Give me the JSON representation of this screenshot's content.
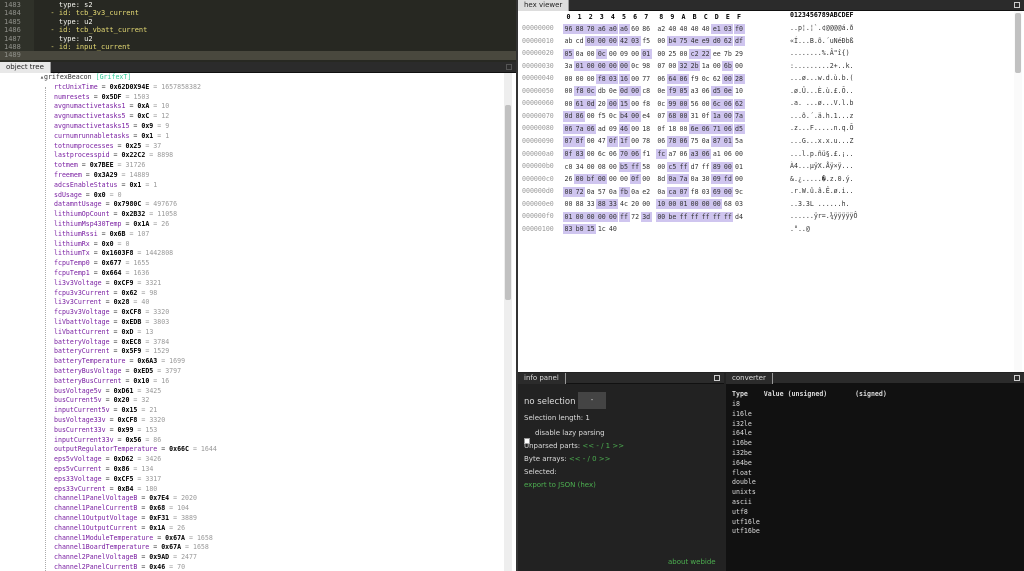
{
  "editor": {
    "lines": [
      {
        "num": "1483",
        "text": "    type: s2",
        "kind": "type"
      },
      {
        "num": "1484",
        "text": "  - id: tcb_3v3_current",
        "kind": "id"
      },
      {
        "num": "1485",
        "text": "    type: u2",
        "kind": "type"
      },
      {
        "num": "1486",
        "text": "  - id: tcb_vbatt_current",
        "kind": "id"
      },
      {
        "num": "1487",
        "text": "    type: u2",
        "kind": "type"
      },
      {
        "num": "1488",
        "text": "  - id: input_current",
        "kind": "id"
      },
      {
        "num": "1489",
        "text": "",
        "kind": "empty"
      }
    ]
  },
  "object_tree": {
    "tab": "object tree",
    "root": "grifexBeacon",
    "root_class": "[GrifexT]",
    "rows": [
      {
        "name": "rtcUnixTime",
        "hex": "0x62D0X94E",
        "dec": "1657858382"
      },
      {
        "name": "numresets",
        "hex": "0x5DF",
        "dec": "1503"
      },
      {
        "name": "avgnumactivetasks1",
        "hex": "0xA",
        "dec": "10"
      },
      {
        "name": "avgnumactivetasks5",
        "hex": "0xC",
        "dec": "12"
      },
      {
        "name": "avgnumactivetasks15",
        "hex": "0x9",
        "dec": "9"
      },
      {
        "name": "curnumrunnabletasks",
        "hex": "0x1",
        "dec": "1"
      },
      {
        "name": "totnumprocesses",
        "hex": "0x25",
        "dec": "37"
      },
      {
        "name": "lastprocesspid",
        "hex": "0x22C2",
        "dec": "8898"
      },
      {
        "name": "totmem",
        "hex": "0x7BEE",
        "dec": "31726"
      },
      {
        "name": "freemem",
        "hex": "0x3A29",
        "dec": "14889"
      },
      {
        "name": "adcsEnableStatus",
        "hex": "0x1",
        "dec": "1"
      },
      {
        "name": "sdUsage",
        "hex": "0x0",
        "dec": "0"
      },
      {
        "name": "datamntUsage",
        "hex": "0x7980C",
        "dec": "497676"
      },
      {
        "name": "lithiumOpCount",
        "hex": "0x2B32",
        "dec": "11058"
      },
      {
        "name": "lithiumMsp430Temp",
        "hex": "0x1A",
        "dec": "26"
      },
      {
        "name": "lithiumRssi",
        "hex": "0x6B",
        "dec": "107"
      },
      {
        "name": "lithiumRx",
        "hex": "0x0",
        "dec": "0"
      },
      {
        "name": "lithiumTx",
        "hex": "0x1603F8",
        "dec": "1442808"
      },
      {
        "name": "fcpuTemp0",
        "hex": "0x677",
        "dec": "1655"
      },
      {
        "name": "fcpuTemp1",
        "hex": "0x664",
        "dec": "1636"
      },
      {
        "name": "li3v3Voltage",
        "hex": "0xCF9",
        "dec": "3321"
      },
      {
        "name": "fcpu3v3Current",
        "hex": "0x62",
        "dec": "98"
      },
      {
        "name": "li3v3Current",
        "hex": "0x28",
        "dec": "40"
      },
      {
        "name": "fcpu3v3Voltage",
        "hex": "0xCF8",
        "dec": "3320"
      },
      {
        "name": "liVbattVoltage",
        "hex": "0xEDB",
        "dec": "3803"
      },
      {
        "name": "liVbattCurrent",
        "hex": "0xD",
        "dec": "13"
      },
      {
        "name": "batteryVoltage",
        "hex": "0xEC8",
        "dec": "3784"
      },
      {
        "name": "batteryCurrent",
        "hex": "0x5F9",
        "dec": "1529"
      },
      {
        "name": "batteryTemperature",
        "hex": "0x6A3",
        "dec": "1699"
      },
      {
        "name": "batteryBusVoltage",
        "hex": "0xED5",
        "dec": "3797"
      },
      {
        "name": "batteryBusCurrent",
        "hex": "0x10",
        "dec": "16"
      },
      {
        "name": "busVoltage5v",
        "hex": "0xD61",
        "dec": "3425"
      },
      {
        "name": "busCurrent5v",
        "hex": "0x20",
        "dec": "32"
      },
      {
        "name": "inputCurrent5v",
        "hex": "0x15",
        "dec": "21"
      },
      {
        "name": "busVoltage33v",
        "hex": "0xCF8",
        "dec": "3320"
      },
      {
        "name": "busCurrent33v",
        "hex": "0x99",
        "dec": "153"
      },
      {
        "name": "inputCurrent33v",
        "hex": "0x56",
        "dec": "86"
      },
      {
        "name": "outputRegulatorTemperature",
        "hex": "0x66C",
        "dec": "1644"
      },
      {
        "name": "eps5vVoltage",
        "hex": "0xD62",
        "dec": "3426"
      },
      {
        "name": "eps5vCurrent",
        "hex": "0x86",
        "dec": "134"
      },
      {
        "name": "eps33Voltage",
        "hex": "0xCF5",
        "dec": "3317"
      },
      {
        "name": "eps33vCurrent",
        "hex": "0xB4",
        "dec": "180"
      },
      {
        "name": "channel1PanelVoltageB",
        "hex": "0x7E4",
        "dec": "2020"
      },
      {
        "name": "channel1PanelCurrentB",
        "hex": "0x68",
        "dec": "104"
      },
      {
        "name": "channel1OutputVoltage",
        "hex": "0xF31",
        "dec": "3889"
      },
      {
        "name": "channel1OutputCurrent",
        "hex": "0x1A",
        "dec": "26"
      },
      {
        "name": "channel1ModuleTemperature",
        "hex": "0x67A",
        "dec": "1658"
      },
      {
        "name": "channel1BoardTemperature",
        "hex": "0x67A",
        "dec": "1658"
      },
      {
        "name": "channel2PanelVoltageB",
        "hex": "0x9AD",
        "dec": "2477"
      },
      {
        "name": "channel2PanelCurrentB",
        "hex": "0x46",
        "dec": "70"
      }
    ]
  },
  "hex_viewer": {
    "tab": "hex viewer",
    "header_cols": [
      "0",
      "1",
      "2",
      "3",
      "4",
      "5",
      "6",
      "7",
      "8",
      "9",
      "A",
      "B",
      "C",
      "D",
      "E",
      "F"
    ],
    "header_ascii": "0123456789ABCDEF",
    "rows": [
      {
        "off": "00000000",
        "bytes": [
          "96",
          "88",
          "70",
          "a6",
          "a0",
          "a6",
          "60",
          "86",
          "a2",
          "40",
          "40",
          "40",
          "40",
          "e1",
          "03",
          "f0"
        ],
        "sel": [
          0,
          1,
          2,
          3,
          4,
          5,
          13,
          14,
          15
        ],
        "ascii": "..p¦.¦`.¢@@@@á.ð"
      },
      {
        "off": "00000010",
        "bytes": [
          "ab",
          "cd",
          "00",
          "00",
          "00",
          "42",
          "03",
          "f5",
          "00",
          "b4",
          "75",
          "4e",
          "e9",
          "d0",
          "62",
          "df"
        ],
        "sel": [
          2,
          3,
          4,
          5,
          6,
          9,
          10,
          11,
          12,
          13,
          14,
          15
        ],
        "ascii": "«Í...B.õ.´uNéÐbß"
      },
      {
        "off": "00000020",
        "bytes": [
          "05",
          "0a",
          "00",
          "0c",
          "00",
          "09",
          "00",
          "01",
          "00",
          "25",
          "00",
          "c2",
          "22",
          "ee",
          "7b",
          "29"
        ],
        "sel": [
          0,
          3,
          7,
          11,
          12
        ],
        "ascii": "........%.Â\"î{)"
      },
      {
        "off": "00000030",
        "bytes": [
          "3a",
          "01",
          "00",
          "00",
          "00",
          "00",
          "0c",
          "98",
          "07",
          "00",
          "32",
          "2b",
          "1a",
          "00",
          "6b",
          "00"
        ],
        "sel": [
          1,
          2,
          3,
          4,
          5,
          10,
          11,
          14
        ],
        "ascii": ":.........2+..k."
      },
      {
        "off": "00000040",
        "bytes": [
          "00",
          "00",
          "00",
          "f8",
          "03",
          "16",
          "00",
          "77",
          "06",
          "64",
          "06",
          "f9",
          "0c",
          "62",
          "00",
          "28"
        ],
        "sel": [
          3,
          4,
          5,
          9,
          10,
          14,
          15
        ],
        "ascii": "...ø...w.d.ù.b.("
      },
      {
        "off": "00000050",
        "bytes": [
          "00",
          "f8",
          "0c",
          "db",
          "0e",
          "0d",
          "00",
          "c8",
          "0e",
          "f9",
          "05",
          "a3",
          "06",
          "d5",
          "0e",
          "10"
        ],
        "sel": [
          1,
          2,
          5,
          6,
          9,
          10,
          13,
          14
        ],
        "ascii": ".ø.Û...È.ù.£.Õ.."
      },
      {
        "off": "00000060",
        "bytes": [
          "00",
          "61",
          "0d",
          "20",
          "00",
          "15",
          "00",
          "f8",
          "0c",
          "99",
          "00",
          "56",
          "00",
          "6c",
          "06",
          "62"
        ],
        "sel": [
          1,
          2,
          4,
          5,
          9,
          10,
          13,
          14,
          15
        ],
        "ascii": ".a. ...ø...V.l.b"
      },
      {
        "off": "00000070",
        "bytes": [
          "0d",
          "86",
          "00",
          "f5",
          "0c",
          "b4",
          "00",
          "e4",
          "07",
          "68",
          "00",
          "31",
          "0f",
          "1a",
          "00",
          "7a"
        ],
        "sel": [
          0,
          1,
          5,
          6,
          9,
          10,
          13,
          14,
          15
        ],
        "ascii": "...õ.´.ä.h.1...z"
      },
      {
        "off": "00000080",
        "bytes": [
          "06",
          "7a",
          "06",
          "ad",
          "09",
          "46",
          "00",
          "18",
          "0f",
          "18",
          "00",
          "6e",
          "06",
          "71",
          "06",
          "d5"
        ],
        "sel": [
          0,
          1,
          2,
          5,
          11,
          12,
          13,
          14,
          15
        ],
        "ascii": ".z...F.....n.q.Õ"
      },
      {
        "off": "00000090",
        "bytes": [
          "07",
          "8f",
          "00",
          "47",
          "0f",
          "1f",
          "00",
          "78",
          "06",
          "78",
          "06",
          "75",
          "0a",
          "87",
          "01",
          "5a"
        ],
        "sel": [
          0,
          1,
          4,
          5,
          9,
          10,
          13,
          14
        ],
        "ascii": "...G...x.x.u...Z"
      },
      {
        "off": "000000a0",
        "bytes": [
          "0f",
          "83",
          "00",
          "6c",
          "06",
          "70",
          "06",
          "f1",
          "fc",
          "a7",
          "06",
          "a3",
          "06",
          "a1",
          "06",
          "00"
        ],
        "sel": [
          0,
          1,
          5,
          6,
          8,
          11,
          12
        ],
        "ascii": "...l.p.ñü§.£.¡.."
      },
      {
        "off": "000000b0",
        "bytes": [
          "c0",
          "34",
          "00",
          "08",
          "00",
          "b5",
          "ff",
          "58",
          "00",
          "c5",
          "ff",
          "d7",
          "ff",
          "89",
          "00",
          "01"
        ],
        "sel": [
          5,
          6,
          9,
          10,
          13,
          14
        ],
        "ascii": "À4...µÿX.Åÿ×ÿ..."
      },
      {
        "off": "000000c0",
        "bytes": [
          "26",
          "00",
          "bf",
          "00",
          "00",
          "00",
          "0f",
          "00",
          "8d",
          "0a",
          "7a",
          "0a",
          "30",
          "09",
          "fd",
          "00"
        ],
        "sel": [
          1,
          2,
          3,
          6,
          9,
          10,
          13,
          14
        ],
        "ascii": "&.¿.....�.z.0.ý."
      },
      {
        "off": "000000d0",
        "bytes": [
          "08",
          "72",
          "0a",
          "57",
          "0a",
          "fb",
          "0a",
          "e2",
          "0a",
          "ca",
          "07",
          "f8",
          "03",
          "69",
          "00",
          "9c"
        ],
        "sel": [
          0,
          1,
          5,
          9,
          10,
          13,
          14
        ],
        "ascii": ".r.W.û.â.Ê.ø.i.."
      },
      {
        "off": "000000e0",
        "bytes": [
          "00",
          "88",
          "33",
          "88",
          "33",
          "4c",
          "20",
          "00",
          "10",
          "00",
          "01",
          "00",
          "00",
          "00",
          "68",
          "03"
        ],
        "sel": [
          3,
          4,
          8,
          9,
          10,
          11,
          12,
          13
        ],
        "ascii": "..3.3L ......h."
      },
      {
        "off": "000000f0",
        "bytes": [
          "01",
          "00",
          "00",
          "00",
          "00",
          "ff",
          "72",
          "3d",
          "00",
          "be",
          "ff",
          "ff",
          "ff",
          "ff",
          "ff",
          "d4"
        ],
        "sel": [
          0,
          1,
          2,
          3,
          4,
          5,
          7,
          8,
          9,
          10,
          11,
          12,
          13,
          14
        ],
        "ascii": "......ÿr=.¾ÿÿÿÿÿÔ"
      },
      {
        "off": "00000100",
        "bytes": [
          "83",
          "b0",
          "15",
          "1c",
          "40"
        ],
        "sel": [
          0,
          1,
          2
        ],
        "ascii": ".°..@"
      }
    ]
  },
  "info_panel": {
    "tab": "info panel",
    "no_selection": "no selection",
    "btn": "-",
    "selection_length": "Selection length: 1",
    "lazy": "disable lazy parsing",
    "unparsed_label": "Unparsed parts: ",
    "unparsed_nav": "<< - / 1 >>",
    "bytearrays_label": "Byte arrays: ",
    "bytearrays_nav": "<< - / 0 >>",
    "selected": "Selected:",
    "export_pre": "export to JSON",
    "export_hex": "(hex)",
    "about": "about webide"
  },
  "converter": {
    "tab": "converter",
    "header": "Type    Value (unsigned)       (signed)",
    "types": [
      "i8",
      "i16le",
      "i32le",
      "i64le",
      "i16be",
      "i32be",
      "i64be",
      "float",
      "double",
      "unixts",
      "ascii",
      "utf8",
      "utf16le",
      "utf16be"
    ]
  },
  "colors": {
    "selection": "#cfc5ef",
    "accent": "#4caf50",
    "editor_bg": "#272822"
  }
}
